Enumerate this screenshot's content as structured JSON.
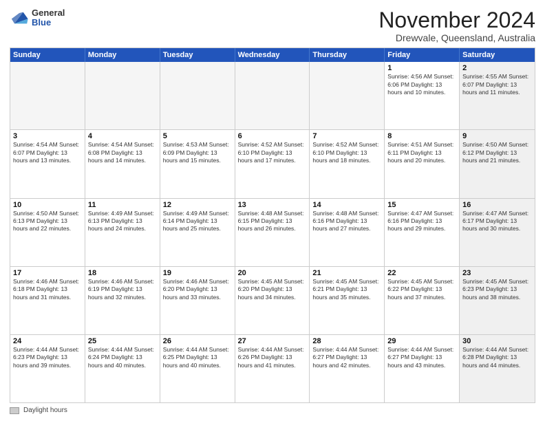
{
  "logo": {
    "general": "General",
    "blue": "Blue"
  },
  "title": {
    "month": "November 2024",
    "location": "Drewvale, Queensland, Australia"
  },
  "header_days": [
    "Sunday",
    "Monday",
    "Tuesday",
    "Wednesday",
    "Thursday",
    "Friday",
    "Saturday"
  ],
  "weeks": [
    {
      "days": [
        {
          "num": "",
          "info": "",
          "empty": true
        },
        {
          "num": "",
          "info": "",
          "empty": true
        },
        {
          "num": "",
          "info": "",
          "empty": true
        },
        {
          "num": "",
          "info": "",
          "empty": true
        },
        {
          "num": "",
          "info": "",
          "empty": true
        },
        {
          "num": "1",
          "info": "Sunrise: 4:56 AM\nSunset: 6:06 PM\nDaylight: 13 hours\nand 10 minutes.",
          "empty": false,
          "shaded": false
        },
        {
          "num": "2",
          "info": "Sunrise: 4:55 AM\nSunset: 6:07 PM\nDaylight: 13 hours\nand 11 minutes.",
          "empty": false,
          "shaded": true
        }
      ]
    },
    {
      "days": [
        {
          "num": "3",
          "info": "Sunrise: 4:54 AM\nSunset: 6:07 PM\nDaylight: 13 hours\nand 13 minutes.",
          "empty": false,
          "shaded": false
        },
        {
          "num": "4",
          "info": "Sunrise: 4:54 AM\nSunset: 6:08 PM\nDaylight: 13 hours\nand 14 minutes.",
          "empty": false,
          "shaded": false
        },
        {
          "num": "5",
          "info": "Sunrise: 4:53 AM\nSunset: 6:09 PM\nDaylight: 13 hours\nand 15 minutes.",
          "empty": false,
          "shaded": false
        },
        {
          "num": "6",
          "info": "Sunrise: 4:52 AM\nSunset: 6:10 PM\nDaylight: 13 hours\nand 17 minutes.",
          "empty": false,
          "shaded": false
        },
        {
          "num": "7",
          "info": "Sunrise: 4:52 AM\nSunset: 6:10 PM\nDaylight: 13 hours\nand 18 minutes.",
          "empty": false,
          "shaded": false
        },
        {
          "num": "8",
          "info": "Sunrise: 4:51 AM\nSunset: 6:11 PM\nDaylight: 13 hours\nand 20 minutes.",
          "empty": false,
          "shaded": false
        },
        {
          "num": "9",
          "info": "Sunrise: 4:50 AM\nSunset: 6:12 PM\nDaylight: 13 hours\nand 21 minutes.",
          "empty": false,
          "shaded": true
        }
      ]
    },
    {
      "days": [
        {
          "num": "10",
          "info": "Sunrise: 4:50 AM\nSunset: 6:13 PM\nDaylight: 13 hours\nand 22 minutes.",
          "empty": false,
          "shaded": false
        },
        {
          "num": "11",
          "info": "Sunrise: 4:49 AM\nSunset: 6:13 PM\nDaylight: 13 hours\nand 24 minutes.",
          "empty": false,
          "shaded": false
        },
        {
          "num": "12",
          "info": "Sunrise: 4:49 AM\nSunset: 6:14 PM\nDaylight: 13 hours\nand 25 minutes.",
          "empty": false,
          "shaded": false
        },
        {
          "num": "13",
          "info": "Sunrise: 4:48 AM\nSunset: 6:15 PM\nDaylight: 13 hours\nand 26 minutes.",
          "empty": false,
          "shaded": false
        },
        {
          "num": "14",
          "info": "Sunrise: 4:48 AM\nSunset: 6:16 PM\nDaylight: 13 hours\nand 27 minutes.",
          "empty": false,
          "shaded": false
        },
        {
          "num": "15",
          "info": "Sunrise: 4:47 AM\nSunset: 6:16 PM\nDaylight: 13 hours\nand 29 minutes.",
          "empty": false,
          "shaded": false
        },
        {
          "num": "16",
          "info": "Sunrise: 4:47 AM\nSunset: 6:17 PM\nDaylight: 13 hours\nand 30 minutes.",
          "empty": false,
          "shaded": true
        }
      ]
    },
    {
      "days": [
        {
          "num": "17",
          "info": "Sunrise: 4:46 AM\nSunset: 6:18 PM\nDaylight: 13 hours\nand 31 minutes.",
          "empty": false,
          "shaded": false
        },
        {
          "num": "18",
          "info": "Sunrise: 4:46 AM\nSunset: 6:19 PM\nDaylight: 13 hours\nand 32 minutes.",
          "empty": false,
          "shaded": false
        },
        {
          "num": "19",
          "info": "Sunrise: 4:46 AM\nSunset: 6:20 PM\nDaylight: 13 hours\nand 33 minutes.",
          "empty": false,
          "shaded": false
        },
        {
          "num": "20",
          "info": "Sunrise: 4:45 AM\nSunset: 6:20 PM\nDaylight: 13 hours\nand 34 minutes.",
          "empty": false,
          "shaded": false
        },
        {
          "num": "21",
          "info": "Sunrise: 4:45 AM\nSunset: 6:21 PM\nDaylight: 13 hours\nand 35 minutes.",
          "empty": false,
          "shaded": false
        },
        {
          "num": "22",
          "info": "Sunrise: 4:45 AM\nSunset: 6:22 PM\nDaylight: 13 hours\nand 37 minutes.",
          "empty": false,
          "shaded": false
        },
        {
          "num": "23",
          "info": "Sunrise: 4:45 AM\nSunset: 6:23 PM\nDaylight: 13 hours\nand 38 minutes.",
          "empty": false,
          "shaded": true
        }
      ]
    },
    {
      "days": [
        {
          "num": "24",
          "info": "Sunrise: 4:44 AM\nSunset: 6:23 PM\nDaylight: 13 hours\nand 39 minutes.",
          "empty": false,
          "shaded": false
        },
        {
          "num": "25",
          "info": "Sunrise: 4:44 AM\nSunset: 6:24 PM\nDaylight: 13 hours\nand 40 minutes.",
          "empty": false,
          "shaded": false
        },
        {
          "num": "26",
          "info": "Sunrise: 4:44 AM\nSunset: 6:25 PM\nDaylight: 13 hours\nand 40 minutes.",
          "empty": false,
          "shaded": false
        },
        {
          "num": "27",
          "info": "Sunrise: 4:44 AM\nSunset: 6:26 PM\nDaylight: 13 hours\nand 41 minutes.",
          "empty": false,
          "shaded": false
        },
        {
          "num": "28",
          "info": "Sunrise: 4:44 AM\nSunset: 6:27 PM\nDaylight: 13 hours\nand 42 minutes.",
          "empty": false,
          "shaded": false
        },
        {
          "num": "29",
          "info": "Sunrise: 4:44 AM\nSunset: 6:27 PM\nDaylight: 13 hours\nand 43 minutes.",
          "empty": false,
          "shaded": false
        },
        {
          "num": "30",
          "info": "Sunrise: 4:44 AM\nSunset: 6:28 PM\nDaylight: 13 hours\nand 44 minutes.",
          "empty": false,
          "shaded": true
        }
      ]
    }
  ],
  "footer": {
    "legend_label": "Daylight hours"
  }
}
